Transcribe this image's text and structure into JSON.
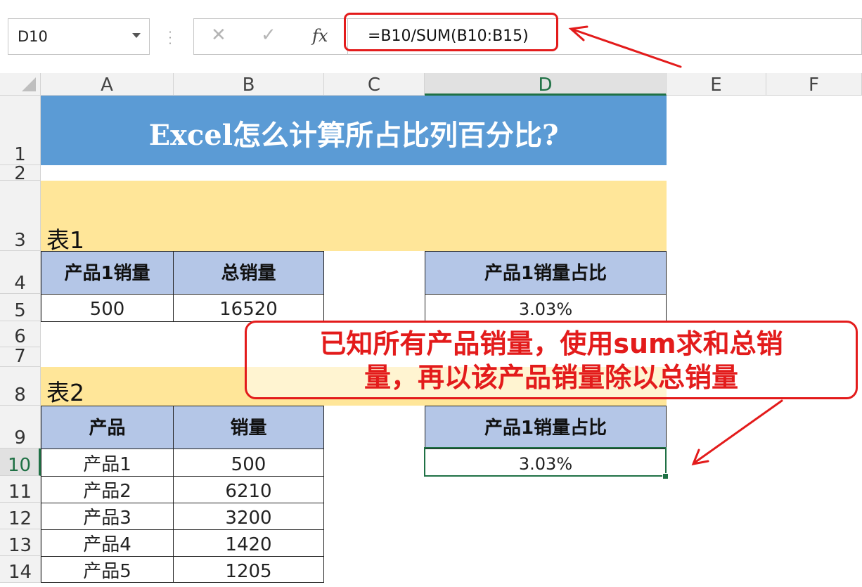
{
  "formula_bar": {
    "name_box": "D10",
    "cancel_icon": "✕",
    "enter_icon": "✓",
    "fx_label": "fx",
    "formula": "=B10/SUM(B10:B15)"
  },
  "columns": [
    "A",
    "B",
    "C",
    "D",
    "E",
    "F"
  ],
  "rows": [
    "1",
    "2",
    "3",
    "4",
    "5",
    "6",
    "7",
    "8",
    "9",
    "10",
    "11",
    "12",
    "13",
    "14"
  ],
  "selected_cell": "D10",
  "title": "Excel怎么计算所占比列百分比?",
  "table1": {
    "label": "表1",
    "headers": [
      "产品1销量",
      "总销量"
    ],
    "values": [
      "500",
      "16520"
    ],
    "ratio_header": "产品1销量占比",
    "ratio_value": "3.03%"
  },
  "table2": {
    "label": "表2",
    "headers": [
      "产品",
      "销量"
    ],
    "rows": [
      {
        "product": "产品1",
        "sales": "500"
      },
      {
        "product": "产品2",
        "sales": "6210"
      },
      {
        "product": "产品3",
        "sales": "3200"
      },
      {
        "product": "产品4",
        "sales": "1420"
      },
      {
        "product": "产品5",
        "sales": "1205"
      }
    ],
    "ratio_header": "产品1销量占比",
    "ratio_value": "3.03%"
  },
  "callout": {
    "line1": "已知所有产品销量，使用sum求和总销",
    "line2": "量，再以该产品销量除以总销量"
  },
  "colors": {
    "title_band": "#5b9bd5",
    "section_band": "#ffe699",
    "table_header": "#b4c6e7",
    "annotation": "#e31b1b",
    "selection": "#1f7145"
  }
}
